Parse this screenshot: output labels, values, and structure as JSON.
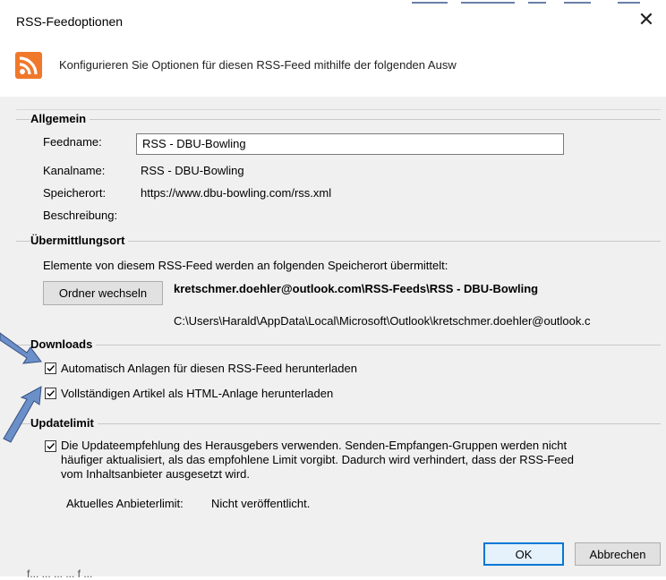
{
  "dialog": {
    "title": "RSS-Feedoptionen",
    "header_text": "Konfigurieren Sie Optionen für diesen RSS-Feed mithilfe der folgenden Ausw"
  },
  "general": {
    "group_label": "Allgemein",
    "feedname_label": "Feedname:",
    "feedname_value": "RSS - DBU-Bowling",
    "kanalname_label": "Kanalname:",
    "kanalname_value": "RSS - DBU-Bowling",
    "speicherort_label": "Speicherort:",
    "speicherort_value": "https://www.dbu-bowling.com/rss.xml",
    "beschreibung_label": "Beschreibung:"
  },
  "delivery": {
    "group_label": "Übermittlungsort",
    "description": "Elemente von diesem RSS-Feed werden an folgenden Speicherort übermittelt:",
    "change_folder_button": "Ordner wechseln",
    "target_folder": "kretschmer.doehler@outlook.com\\RSS-Feeds\\RSS - DBU-Bowling",
    "target_path": "C:\\Users\\Harald\\AppData\\Local\\Microsoft\\Outlook\\kretschmer.doehler@outlook.c"
  },
  "downloads": {
    "group_label": "Downloads",
    "attachments_label": "Automatisch Anlagen für diesen RSS-Feed herunterladen",
    "attachments_checked": true,
    "fullarticle_label": "Vollständigen Artikel als HTML-Anlage herunterladen",
    "fullarticle_checked": true
  },
  "update_limit": {
    "group_label": "Updatelimit",
    "publisher_recommendation_line1": "Die Updateempfehlung des Herausgebers verwenden. Senden-Empfangen-Gruppen werden nicht",
    "publisher_recommendation_line2": "häufiger aktualisiert, als das empfohlene Limit vorgibt. Dadurch wird verhindert, dass der RSS-Feed",
    "publisher_recommendation_line3": "vom Inhaltsanbieter ausgesetzt wird.",
    "publisher_recommendation_checked": true,
    "current_limit_label": "Aktuelles Anbieterlimit:",
    "current_limit_value": "Nicht veröffentlicht."
  },
  "buttons": {
    "ok": "OK",
    "cancel": "Abbrechen"
  },
  "background_text": "f... ... ... ... f ... ",
  "colors": {
    "rss_orange": "#f0782a",
    "accent_blue": "#0078d7",
    "annotation_arrow": "#6b8fc9"
  }
}
